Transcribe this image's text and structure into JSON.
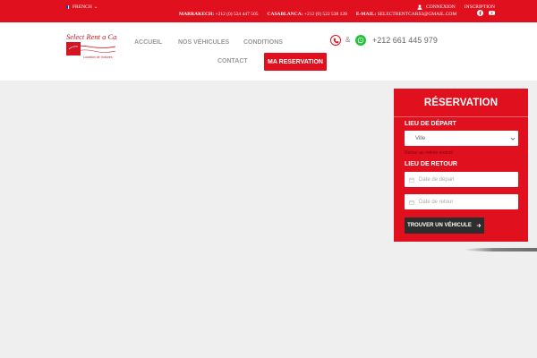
{
  "topbar": {
    "language": "FRENCH",
    "login": "CONNEXION",
    "register": "INSCRIPTION",
    "contacts": [
      {
        "city": "MARRAKECH:",
        "value": "+212 (0) 524 447 505"
      },
      {
        "city": "CASABLANCA:",
        "value": "+212 (0) 522 538 128"
      },
      {
        "city": "E-MAIL:",
        "value": "SELECTRENTCARS2@GMAIL.COM"
      }
    ]
  },
  "logo": {
    "top_text": "Select Rent a Car",
    "bottom_text": "Location de Voitures"
  },
  "nav": {
    "home": "ACCUEIL",
    "vehicles": "NOS VÉHICULES",
    "conditions": "CONDITIONS",
    "contact": "CONTACT",
    "reservation": "MA RESERVATION"
  },
  "header_contact": {
    "ampersand": "&",
    "phone": "+212 661 445 979"
  },
  "reservation": {
    "title": "RÉSERVATION",
    "departure_label": "LIEU DE DÉPART",
    "city_value": "Ville",
    "same_agency": "Retour au même endroit",
    "return_label": "LIEU DE RETOUR",
    "departure_date_placeholder": "Date de départ",
    "return_date_placeholder": "Date de retour",
    "search_button": "TROUVER UN VÉHICULE"
  },
  "colors": {
    "brand_red": "#e0101f",
    "dark_button": "#2d2d2d",
    "whatsapp_green": "#25c13a"
  }
}
